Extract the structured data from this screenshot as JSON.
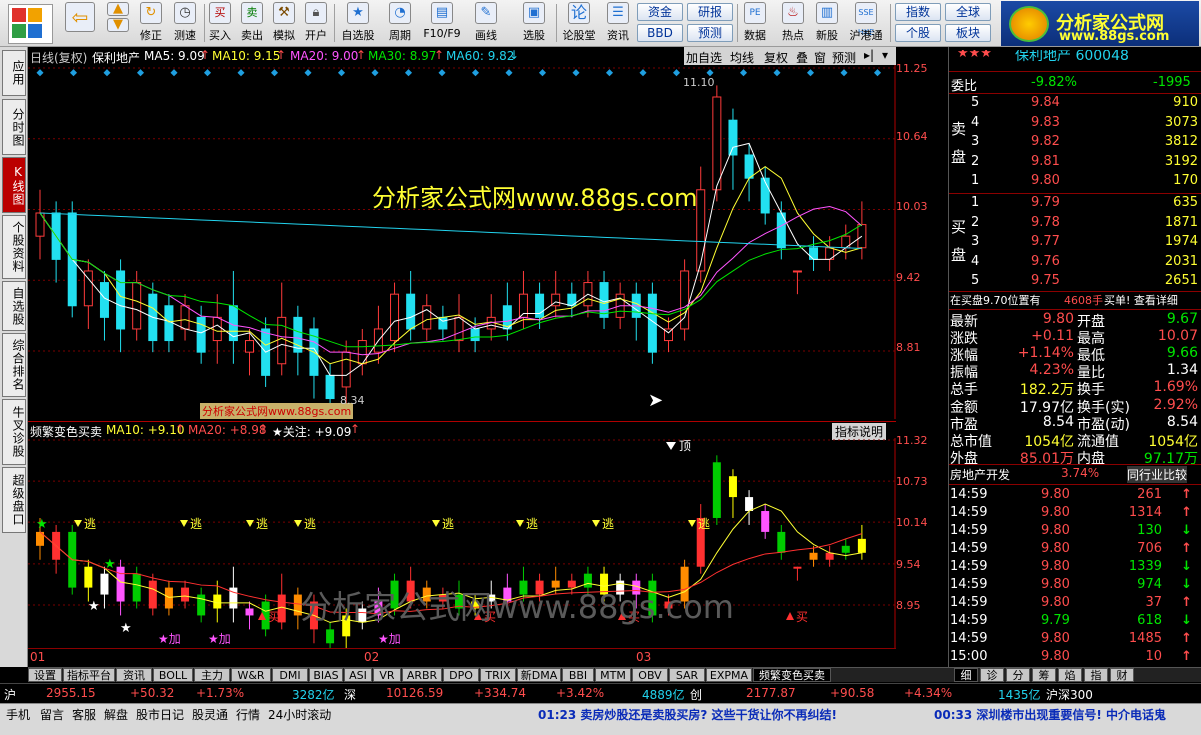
{
  "toolbar": {
    "buttons": [
      "",
      "",
      "修正",
      "测速",
      "买入",
      "卖出",
      "模拟",
      "开户",
      "自选股",
      "周期",
      "F10/F9",
      "画线",
      "选股",
      "论股堂",
      "资讯",
      "数据",
      "热点",
      "新股",
      "沪港通"
    ],
    "small_buttons": [
      "资金",
      "研报",
      "BBD",
      "预测",
      "指数",
      "全球",
      "个股",
      "板块"
    ],
    "ad_title": "分析家公式网",
    "ad_url": "www.88gs.com"
  },
  "left_tabs": [
    "应用",
    "分时图",
    "K线图",
    "个股资料",
    "自选股",
    "综合排名",
    "牛叉诊股",
    "超级盘口"
  ],
  "main_chart": {
    "header": {
      "mode": "日线(复权)",
      "name": "保利地产",
      "ma5": "MA5: 9.09",
      "ma10": "MA10: 9.15",
      "ma20": "MA20: 9.00",
      "ma30": "MA30: 8.97",
      "ma60": "MA60: 9.82"
    },
    "toolbar_buttons": [
      "加自选",
      "均线",
      "复权",
      "叠",
      "窗",
      "预测"
    ],
    "watermark": "分析家公式网www.88gs.com",
    "watermark_small": "分析家公式网www.88gs.com",
    "high_label": "11.10",
    "low_label": "8.34",
    "y_ticks": [
      "11.25",
      "10.64",
      "10.03",
      "9.42",
      "8.81"
    ]
  },
  "indicator": {
    "header_name": "频繁变色买卖",
    "ma10": "MA10: +9.10",
    "ma20": "MA20: +8.98",
    "focus": "★关注: +9.09",
    "explain_button": "指标说明",
    "y_ticks": [
      "11.32",
      "10.73",
      "10.14",
      "9.54",
      "8.95"
    ],
    "signal_top": "顶",
    "signal_escape": "逃",
    "signal_buy": "买",
    "signal_add": "加",
    "watermark": "分析家公式网www.88gs.com"
  },
  "x_axis": [
    "01",
    "02",
    "03"
  ],
  "bottom_tabs": [
    "设置",
    "指标平台",
    "资讯",
    "BOLL",
    "主力",
    "W&R",
    "DMI",
    "BIAS",
    "ASI",
    "VR",
    "ARBR",
    "DPO",
    "TRIX",
    "新DMA",
    "BBI",
    "MTM",
    "OBV",
    "SAR",
    "EXPMA",
    "频繁变色买卖"
  ],
  "status": {
    "sh_label": "沪",
    "sh_index": "2955.15",
    "sh_change": "+50.32",
    "sh_pct": "+1.73%",
    "sh_amount": "3282亿",
    "sz_label": "深",
    "sz_index": "10126.59",
    "sz_change": "+334.74",
    "sz_pct": "+3.42%",
    "cy_amount": "4889亿",
    "cy_label": "创",
    "cy_index": "2177.87",
    "cy_change": "+90.58",
    "cy_pct": "+4.34%",
    "hs_amount": "1435亿",
    "hs_label": "沪深300"
  },
  "info_bar": {
    "links": [
      "手机",
      "留言",
      "客服",
      "解盘",
      "股市日记",
      "股灵通",
      "行情",
      "24小时滚动"
    ],
    "news1": "01:23 卖房炒股还是卖股买房? 这些干货让你不再纠结!",
    "news2": "00:33 深圳楼市出现重要信号! 中介电话鬼"
  },
  "right_panel": {
    "title": "保利地产 600048",
    "stars": "★★★",
    "weibi_label": "委比",
    "weibi_pct": "-9.82%",
    "weicha": "-1995",
    "sell_label": "卖盘",
    "buy_label": "买盘",
    "sell": [
      {
        "level": "5",
        "price": "9.84",
        "vol": "910"
      },
      {
        "level": "4",
        "price": "9.83",
        "vol": "3073"
      },
      {
        "level": "3",
        "price": "9.82",
        "vol": "3812"
      },
      {
        "level": "2",
        "price": "9.81",
        "vol": "3192"
      },
      {
        "level": "1",
        "price": "9.80",
        "vol": "170"
      }
    ],
    "buy": [
      {
        "level": "1",
        "price": "9.79",
        "vol": "635"
      },
      {
        "level": "2",
        "price": "9.78",
        "vol": "1871"
      },
      {
        "level": "3",
        "price": "9.77",
        "vol": "1974"
      },
      {
        "level": "4",
        "price": "9.76",
        "vol": "2031"
      },
      {
        "level": "5",
        "price": "9.75",
        "vol": "2651"
      }
    ],
    "bid_note": "在买盘9.70位置有",
    "bid_note_vol": "4608手",
    "bid_note_action": "买单! 查看详细",
    "quote": [
      {
        "l1": "最新",
        "v1": "9.80",
        "l2": "开盘",
        "v2": "9.67"
      },
      {
        "l1": "涨跌",
        "v1": "+0.11",
        "l2": "最高",
        "v2": "10.07"
      },
      {
        "l1": "涨幅",
        "v1": "+1.14%",
        "l2": "最低",
        "v2": "9.66"
      },
      {
        "l1": "振幅",
        "v1": "4.23%",
        "l2": "量比",
        "v2": "1.34"
      },
      {
        "l1": "总手",
        "v1": "182.2万",
        "l2": "换手",
        "v2": "1.69%"
      },
      {
        "l1": "金额",
        "v1": "17.97亿",
        "l2": "换手(实)",
        "v2": "2.92%"
      },
      {
        "l1": "市盈",
        "v1": "8.54",
        "l2": "市盈(动)",
        "v2": "8.54"
      },
      {
        "l1": "总市值",
        "v1": "1054亿",
        "l2": "流通值",
        "v2": "1054亿"
      },
      {
        "l1": "外盘",
        "v1": "85.01万",
        "l2": "内盘",
        "v2": "97.17万"
      }
    ],
    "sector_name": "房地产开发",
    "sector_pct": "3.74%",
    "sector_button": "同行业比较",
    "ticks": [
      {
        "t": "14:59",
        "p": "9.80",
        "v": "261",
        "d": "up"
      },
      {
        "t": "14:59",
        "p": "9.80",
        "v": "1314",
        "d": "up"
      },
      {
        "t": "14:59",
        "p": "9.80",
        "v": "130",
        "d": "down"
      },
      {
        "t": "14:59",
        "p": "9.80",
        "v": "706",
        "d": "up"
      },
      {
        "t": "14:59",
        "p": "9.80",
        "v": "1339",
        "d": "down"
      },
      {
        "t": "14:59",
        "p": "9.80",
        "v": "974",
        "d": "down"
      },
      {
        "t": "14:59",
        "p": "9.80",
        "v": "37",
        "d": "up"
      },
      {
        "t": "14:59",
        "p": "9.79",
        "v": "618",
        "d": "down"
      },
      {
        "t": "14:59",
        "p": "9.80",
        "v": "1485",
        "d": "up"
      },
      {
        "t": "15:00",
        "p": "9.80",
        "v": "10",
        "d": "up"
      }
    ],
    "bottom_tabs": [
      "细",
      "诊",
      "分",
      "筹",
      "焰",
      "指",
      "财"
    ]
  },
  "colors": {
    "up": "#ff4d4d",
    "down": "#22d3ee",
    "ma5": "#ffffff",
    "ma10": "#ffff33",
    "ma20": "#ff55ff",
    "ma30": "#00e600",
    "ma60": "#22d3ee"
  }
}
